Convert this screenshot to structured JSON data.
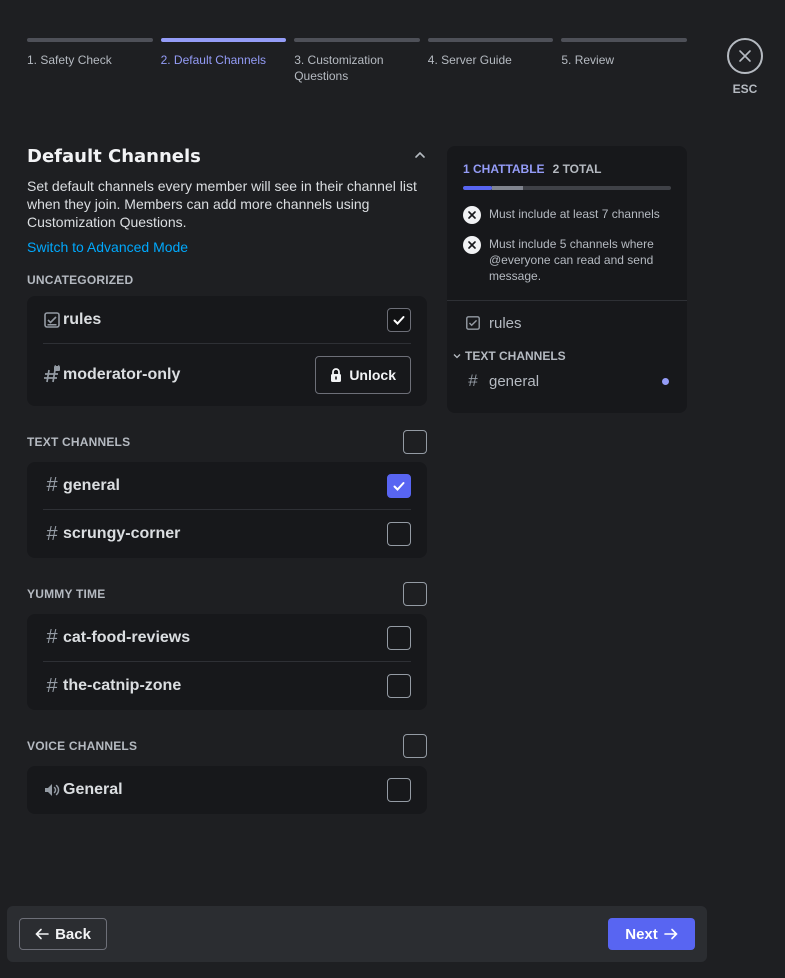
{
  "stepper": {
    "steps": [
      {
        "label": "1. Safety Check"
      },
      {
        "label": "2. Default Channels"
      },
      {
        "label": "3. Customization Questions"
      },
      {
        "label": "4. Server Guide"
      },
      {
        "label": "5. Review"
      }
    ],
    "active_index": 1
  },
  "close": {
    "icon": "close-icon",
    "label": "ESC"
  },
  "section": {
    "title": "Default Channels",
    "description": "Set default channels every member will see in their channel list when they join. Members can add more channels using Customization Questions.",
    "advanced_link": "Switch to Advanced Mode"
  },
  "categories": {
    "uncategorized": {
      "title": "UNCATEGORIZED",
      "channels": [
        {
          "name": "rules",
          "icon": "rules-channel-icon",
          "checked": true
        },
        {
          "name": "moderator-only",
          "icon": "locked-text-channel-icon",
          "action": "Unlock"
        }
      ]
    },
    "text": {
      "title": "TEXT CHANNELS",
      "checked": false,
      "channels": [
        {
          "name": "general",
          "icon": "text-channel-icon",
          "checked": true
        },
        {
          "name": "scrungy-corner",
          "icon": "text-channel-icon",
          "checked": false
        }
      ]
    },
    "yummy": {
      "title": "YUMMY TIME",
      "checked": false,
      "channels": [
        {
          "name": "cat-food-reviews",
          "icon": "text-channel-icon",
          "checked": false
        },
        {
          "name": "the-catnip-zone",
          "icon": "text-channel-icon",
          "checked": false
        }
      ]
    },
    "voice": {
      "title": "VOICE CHANNELS",
      "checked": false,
      "channels": [
        {
          "name": "General",
          "icon": "voice-channel-icon",
          "checked": false
        }
      ]
    }
  },
  "summary": {
    "chattable": "1 CHATTABLE",
    "total": "2 TOTAL",
    "progress": {
      "chattable_fraction": 0.14,
      "total_fraction": 0.29
    },
    "requirements": [
      {
        "text": "Must include at least 7 channels",
        "icon": "x-circle-icon"
      },
      {
        "text": "Must include 5 channels where @everyone can read and send message.",
        "icon": "x-circle-icon"
      }
    ],
    "preview": {
      "top_item": "rules",
      "category": "TEXT CHANNELS",
      "items": [
        {
          "name": "general",
          "unread": true
        }
      ]
    }
  },
  "footer": {
    "back_label": "Back",
    "next_label": "Next"
  },
  "colors": {
    "accent": "#5865f2",
    "accent_light": "#949cf7",
    "link": "#00a8fc",
    "background": "#1e1f22",
    "card": "#17181b"
  }
}
